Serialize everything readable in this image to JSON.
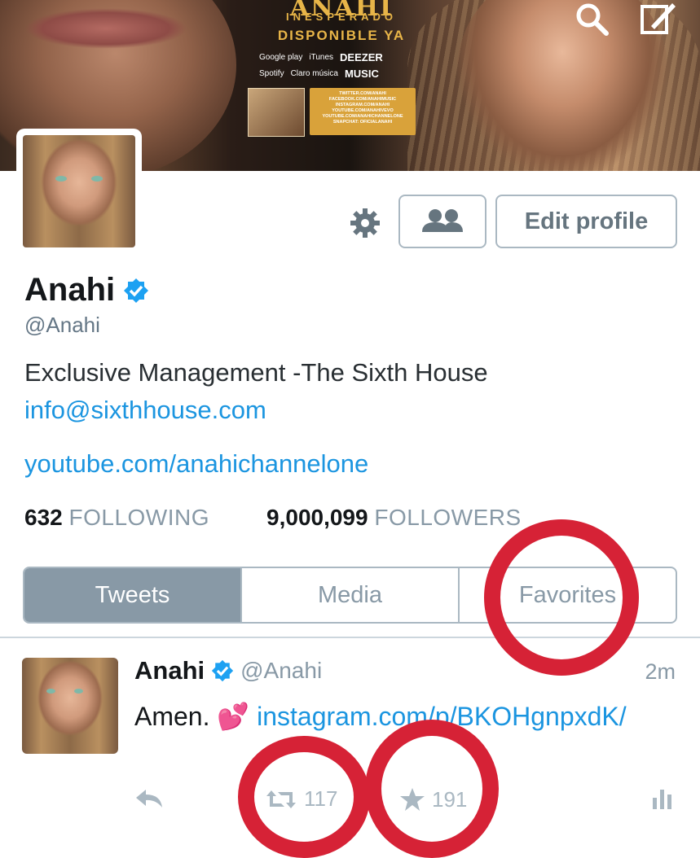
{
  "header": {
    "promo_title": "ANAHI",
    "promo_subtitle": "INESPERADO",
    "promo_available": "DISPONIBLE YA",
    "stores": [
      "Google play",
      "iTunes",
      "DEEZER",
      "Spotify",
      "Claro música",
      "MUSIC"
    ],
    "social_links": [
      "TWITTER.COM/ANAHI",
      "FACEBOOK.COM/ANAHIMUSIC",
      "INSTAGRAM.COM/ANAHI",
      "YOUTUBE.COM/ANAHIVEVO",
      "YOUTUBE.COM/ANAHICHANNELONE",
      "SNAPCHAT: OFICIALANAHI"
    ],
    "icons": [
      "search-icon",
      "compose-icon"
    ]
  },
  "profile": {
    "name": "Anahi",
    "handle": "@Anahi",
    "bio": "Exclusive Management -The Sixth House",
    "email": "info@sixthhouse.com",
    "website": "youtube.com/anahichannelone",
    "following_count": "632",
    "following_label": "FOLLOWING",
    "followers_count": "9,000,099",
    "followers_label": "FOLLOWERS",
    "edit_label": "Edit profile",
    "verified": true
  },
  "tabs": [
    {
      "label": "Tweets",
      "active": true
    },
    {
      "label": "Media",
      "active": false
    },
    {
      "label": "Favorites",
      "active": false
    }
  ],
  "tweet": {
    "name": "Anahi",
    "handle": "@Anahi",
    "time": "2m",
    "text_prefix": "Amen. ",
    "emoji": "💕",
    "link": "instagram.com/p/BKOHgnpxdK/",
    "retweets": "117",
    "favorites": "191"
  },
  "colors": {
    "accent": "#1b95e0",
    "annotation": "#d62236",
    "muted": "#8899a6"
  }
}
